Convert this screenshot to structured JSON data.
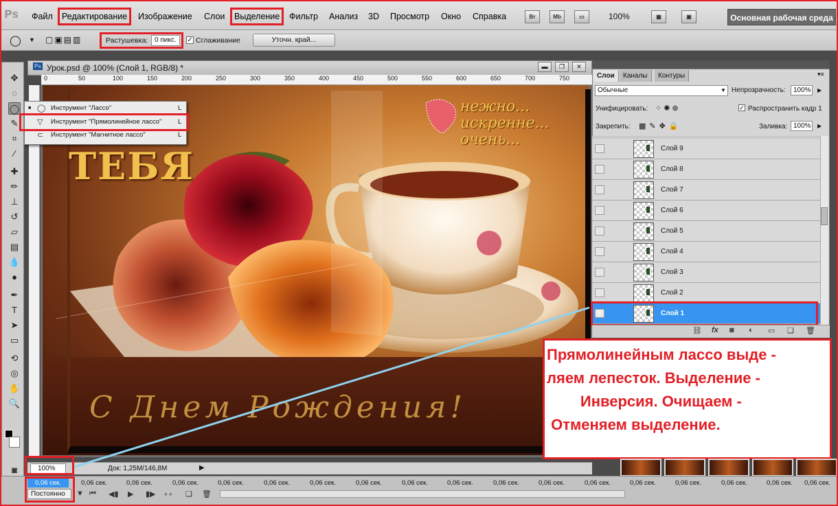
{
  "app": {
    "logo": "Ps"
  },
  "menu": [
    "Файл",
    "Редактирование",
    "Изображение",
    "Слои",
    "Выделение",
    "Фильтр",
    "Анализ",
    "3D",
    "Просмотр",
    "Окно",
    "Справка"
  ],
  "top_buttons": {
    "bridge": "Br",
    "mini_bridge": "Mb",
    "zoom": "100%",
    "workspace": "Основная рабочая среда"
  },
  "options": {
    "feather_label": "Растушевка:",
    "feather_value": "0 пикс.",
    "antialias_label": "Сглаживание",
    "antialias_checked": "✓",
    "refine_button": "Уточн. край..."
  },
  "tool_flyout": [
    {
      "bullet": "■",
      "label": "Инструмент \"Лассо\"",
      "key": "L"
    },
    {
      "bullet": "",
      "label": "Инструмент \"Прямолинейное лассо\"",
      "key": "L"
    },
    {
      "bullet": "",
      "label": "Инструмент \"Магнитное лассо\"",
      "key": "L"
    }
  ],
  "document": {
    "title": "Урок.psd @ 100% (Слой 1, RGB/8) *",
    "ruler_ticks": [
      "0",
      "50",
      "100",
      "150",
      "200",
      "250",
      "300",
      "350",
      "400",
      "450",
      "500",
      "550",
      "600",
      "650",
      "700",
      "750"
    ],
    "zoom": "100%",
    "doc_size": "Док: 1,25M/146,8M"
  },
  "artwork_text": {
    "top": "нежно...\nискренне...\nочень...",
    "left": "ТЕБЯ",
    "bottom": "С Днем Рождения!"
  },
  "layers_panel": {
    "tabs": [
      "Слои",
      "Каналы",
      "Контуры"
    ],
    "blend_mode": "Обычные",
    "opacity_label": "Непрозрачность:",
    "opacity": "100%",
    "unify_label": "Унифицировать:",
    "propagate_label": "Распространить кадр 1",
    "lock_label": "Закрепить:",
    "fill_label": "Заливка:",
    "fill": "100%",
    "layers": [
      {
        "name": "Слой 9",
        "visible": ""
      },
      {
        "name": "Слой 8",
        "visible": ""
      },
      {
        "name": "Слой 7",
        "visible": ""
      },
      {
        "name": "Слой 6",
        "visible": ""
      },
      {
        "name": "Слой 5",
        "visible": ""
      },
      {
        "name": "Слой 4",
        "visible": ""
      },
      {
        "name": "Слой 3",
        "visible": ""
      },
      {
        "name": "Слой 2",
        "visible": ""
      },
      {
        "name": "Слой 1",
        "visible": "👁"
      }
    ],
    "selected_layer": "Слой 1",
    "footer_icons": [
      "link-icon",
      "fx-icon",
      "mask-icon",
      "adjustment-icon",
      "folder-icon",
      "new-layer-icon",
      "trash-icon"
    ]
  },
  "animation": {
    "frames": [
      "0,06 сек.",
      "0,06 сек.",
      "0,06 сек.",
      "0,06 сек.",
      "0,06 сек.",
      "0,06 сек.",
      "0,06 сек.",
      "0,06 сек.",
      "0,06 сек.",
      "0,06 сек.",
      "0,06 сек.",
      "0,06 сек.",
      "0,06 сек.",
      "0,06 сек.",
      "0,06 сек.",
      "0,06 сек.",
      "0,06 сек.",
      "0,06 сек.",
      "0,06 сек.",
      "0,06 сек."
    ],
    "loop": "Постоянно"
  },
  "annotation": "Прямолинейным лассо выде -\nляем лепесток. Выделение -\n        Инверсия. Очищаем -\n Отменяем выделение.",
  "colors": {
    "accent_red": "#e21f26",
    "selection_blue": "#3794f0",
    "arrow": "#8fd3ee"
  }
}
